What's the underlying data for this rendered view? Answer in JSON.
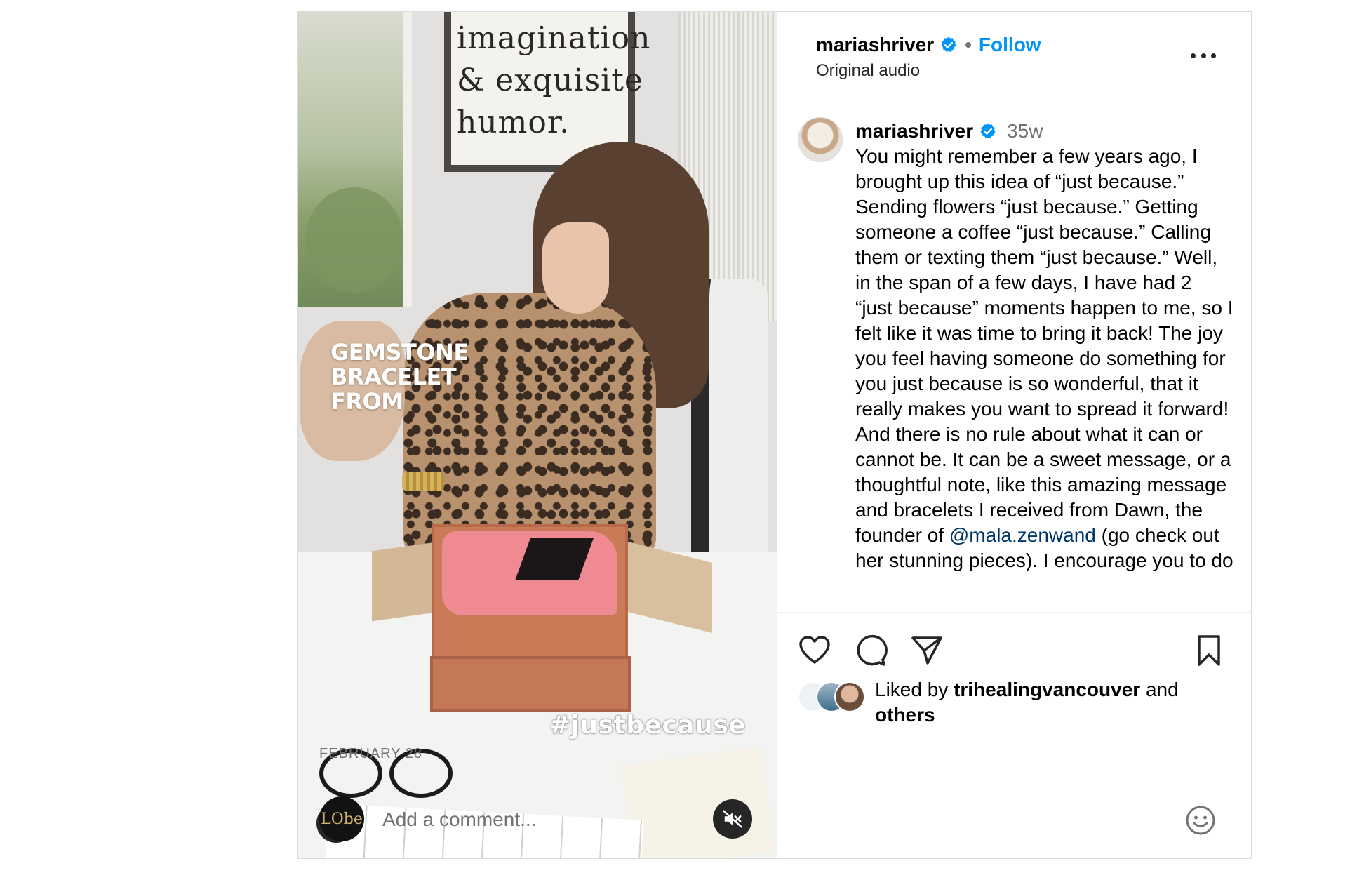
{
  "media": {
    "sign_lines": [
      "imagination",
      "& exquisite",
      "humor."
    ],
    "overlay_lines": [
      "GEMSTONE",
      "BRACELET",
      "FROM"
    ],
    "hashtag": "#justbecause"
  },
  "header": {
    "username": "mariashriver",
    "separator": "•",
    "follow_label": "Follow",
    "audio": "Original audio"
  },
  "caption": {
    "username": "mariashriver",
    "time": "35w",
    "text_before_mention": "You might remember a few years ago, I brought up this idea of “just because.” Sending flowers “just because.” Getting someone a coffee “just because.” Calling them or texting them “just because.” Well, in the span of a few days, I have had 2 “just because” moments happen to me, so I felt like it was time to bring it back! The joy you feel having someone do something for you just because is so wonderful, that it really makes you want to spread it forward! And there is no rule about what it can or cannot be. It can be a sweet message, or a thoughtful note, like this amazing message and bracelets I received from Dawn, the founder of ",
    "mention": "@mala.zenwand",
    "text_after_mention": " (go check out her stunning pieces). I encourage you to do"
  },
  "likes": {
    "prefix": "Liked by ",
    "user": "trihealingvancouver",
    "middle": " and",
    "suffix": "others"
  },
  "date": "FEBRUARY 28",
  "comment": {
    "avatar_text": "LObe",
    "placeholder": "Add a comment..."
  },
  "colors": {
    "accent": "#0095f6",
    "mention": "#00376b",
    "verified": "#0095f6",
    "muted_text": "#737373"
  },
  "icons": [
    "verified-badge-icon",
    "more-options-icon",
    "heart-icon",
    "comment-icon",
    "share-icon",
    "bookmark-icon",
    "emoji-icon",
    "user-tag-icon",
    "muted-speaker-icon"
  ]
}
